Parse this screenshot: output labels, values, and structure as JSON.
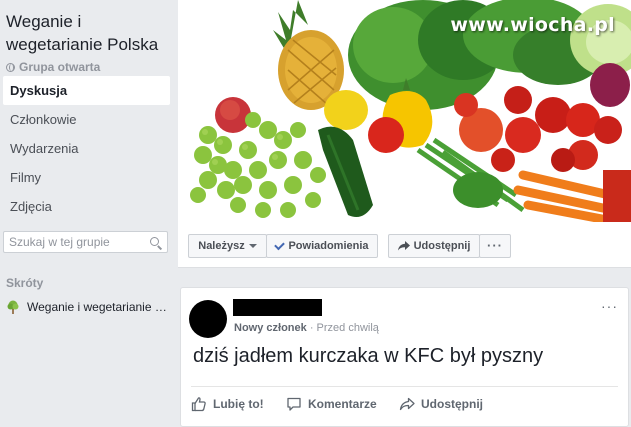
{
  "group": {
    "name": "Weganie i wegetarianie Polska",
    "type": "Grupa otwarta"
  },
  "nav": {
    "items": [
      {
        "label": "Dyskusja",
        "active": true
      },
      {
        "label": "Członkowie",
        "active": false
      },
      {
        "label": "Wydarzenia",
        "active": false
      },
      {
        "label": "Filmy",
        "active": false
      },
      {
        "label": "Zdjęcia",
        "active": false
      }
    ]
  },
  "search": {
    "placeholder": "Szukaj w tej grupie"
  },
  "shortcuts": {
    "title": "Skróty",
    "items": [
      {
        "label": "Weganie i wegetarianie Polska"
      }
    ]
  },
  "cover": {
    "watermark": "www.wiocha.pl"
  },
  "actionbar": {
    "joined_label": "Należysz",
    "notifications_label": "Powiadomienia",
    "share_label": "Udostępnij",
    "more_label": "···"
  },
  "post": {
    "author_role": "Nowy członek",
    "separator": "·",
    "time": "Przed chwilą",
    "text": "dziś jadłem kurczaka w KFC był pyszny",
    "menu": "···",
    "like_label": "Lubię to!",
    "comment_label": "Komentarze",
    "share_label": "Udostępnij"
  },
  "colors": {
    "page_bg": "#e9ebee",
    "link_blue": "#4267b2",
    "muted_text": "#90949c"
  }
}
